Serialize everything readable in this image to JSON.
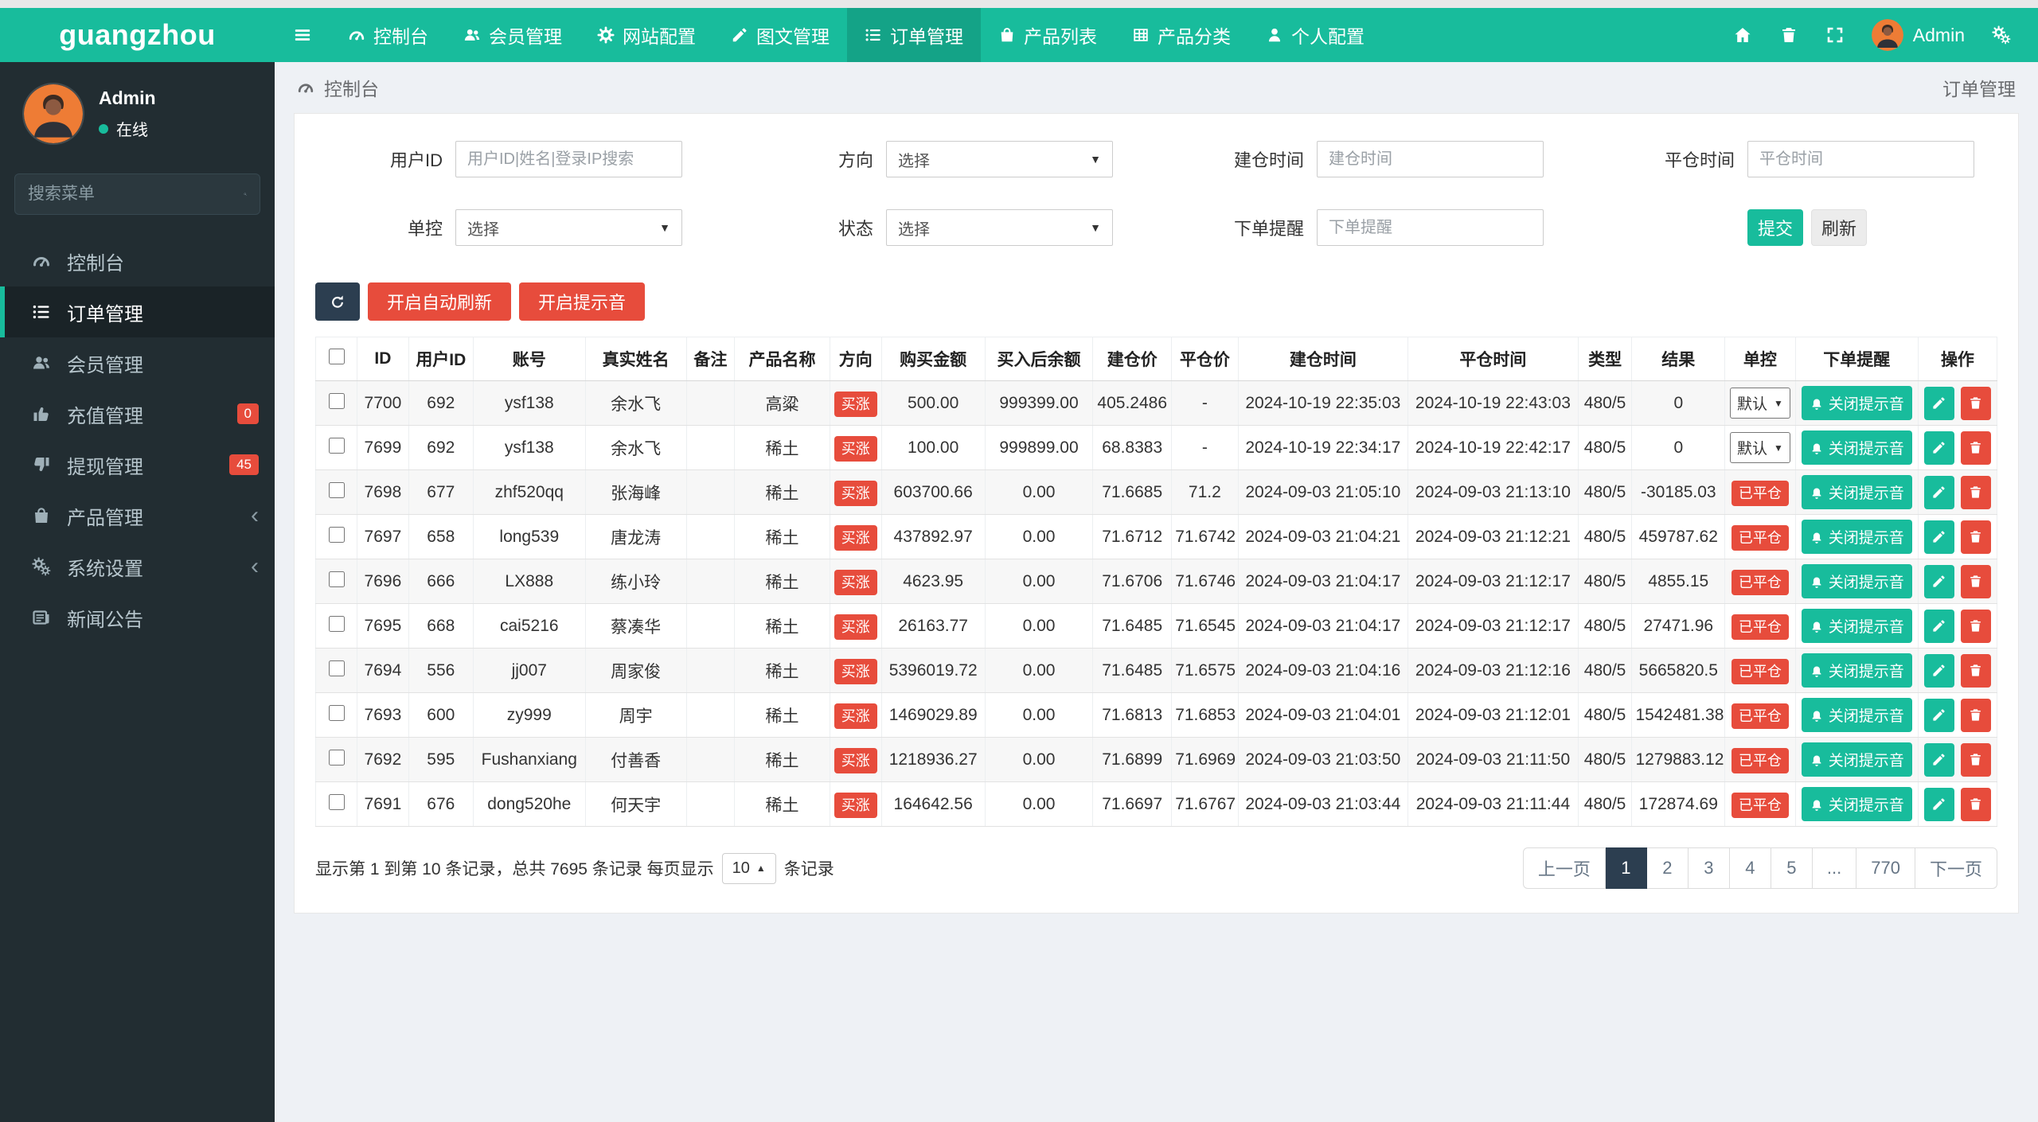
{
  "navbar": {
    "logo": "guangzhou",
    "items": [
      {
        "key": "dashboard",
        "label": "控制台",
        "icon": "gauge",
        "active": false
      },
      {
        "key": "members",
        "label": "会员管理",
        "icon": "users",
        "active": false
      },
      {
        "key": "site-config",
        "label": "网站配置",
        "icon": "gear",
        "active": false
      },
      {
        "key": "content",
        "label": "图文管理",
        "icon": "pen",
        "active": false
      },
      {
        "key": "orders",
        "label": "订单管理",
        "icon": "list",
        "active": true
      },
      {
        "key": "product-list",
        "label": "产品列表",
        "icon": "bag",
        "active": false
      },
      {
        "key": "product-category",
        "label": "产品分类",
        "icon": "table",
        "active": false
      },
      {
        "key": "personal-config",
        "label": "个人配置",
        "icon": "user",
        "active": false
      }
    ],
    "admin_label": "Admin"
  },
  "sidebar": {
    "profile": {
      "name": "Admin",
      "status": "在线"
    },
    "search_placeholder": "搜索菜单",
    "items": [
      {
        "key": "dashboard",
        "label": "控制台",
        "icon": "gauge",
        "active": false,
        "badge": "",
        "chevron": false
      },
      {
        "key": "orders",
        "label": "订单管理",
        "icon": "list",
        "active": true,
        "badge": "",
        "chevron": false
      },
      {
        "key": "members",
        "label": "会员管理",
        "icon": "users",
        "active": false,
        "badge": "",
        "chevron": false
      },
      {
        "key": "recharge",
        "label": "充值管理",
        "icon": "thumb-up",
        "active": false,
        "badge": "0",
        "chevron": false
      },
      {
        "key": "withdraw",
        "label": "提现管理",
        "icon": "thumb-down",
        "active": false,
        "badge": "45",
        "chevron": false
      },
      {
        "key": "products",
        "label": "产品管理",
        "icon": "bag",
        "active": false,
        "badge": "",
        "chevron": true
      },
      {
        "key": "system",
        "label": "系统设置",
        "icon": "cogs",
        "active": false,
        "badge": "",
        "chevron": true
      },
      {
        "key": "news",
        "label": "新闻公告",
        "icon": "news",
        "active": false,
        "badge": "",
        "chevron": false
      }
    ]
  },
  "breadcrumb": {
    "title": "控制台",
    "right": "订单管理"
  },
  "filters": {
    "user_id_label": "用户ID",
    "user_id_placeholder": "用户ID|姓名|登录IP搜索",
    "direction_label": "方向",
    "direction_value": "选择",
    "open_time_label": "建仓时间",
    "open_time_placeholder": "建仓时间",
    "close_time_label": "平仓时间",
    "close_time_placeholder": "平仓时间",
    "control_label": "单控",
    "control_value": "选择",
    "status_label": "状态",
    "status_value": "选择",
    "remind_label": "下单提醒",
    "remind_placeholder": "下单提醒",
    "submit_label": "提交",
    "refresh_label": "刷新"
  },
  "toolbar": {
    "auto_refresh_label": "开启自动刷新",
    "sound_label": "开启提示音"
  },
  "table": {
    "headers": [
      "ID",
      "用户ID",
      "账号",
      "真实姓名",
      "备注",
      "产品名称",
      "方向",
      "购买金额",
      "买入后余额",
      "建仓价",
      "平仓价",
      "建仓时间",
      "平仓时间",
      "类型",
      "结果",
      "单控",
      "下单提醒",
      "操作"
    ],
    "control_select_value": "默认",
    "closed_badge": "已平仓",
    "remind_button_label": "关闭提示音",
    "rows": [
      {
        "id": "7700",
        "uid": "692",
        "account": "ysf138",
        "name": "余水飞",
        "remark": "",
        "product": "高粱",
        "direction": "买涨",
        "amount": "500.00",
        "balance": "999399.00",
        "open_price": "405.2486",
        "close_price": "-",
        "open_time": "2024-10-19 22:35:03",
        "close_time": "2024-10-19 22:43:03",
        "type": "480/5",
        "result": "0",
        "control": "default"
      },
      {
        "id": "7699",
        "uid": "692",
        "account": "ysf138",
        "name": "余水飞",
        "remark": "",
        "product": "稀土",
        "direction": "买涨",
        "amount": "100.00",
        "balance": "999899.00",
        "open_price": "68.8383",
        "close_price": "-",
        "open_time": "2024-10-19 22:34:17",
        "close_time": "2024-10-19 22:42:17",
        "type": "480/5",
        "result": "0",
        "control": "default"
      },
      {
        "id": "7698",
        "uid": "677",
        "account": "zhf520qq",
        "name": "张海峰",
        "remark": "",
        "product": "稀土",
        "direction": "买涨",
        "amount": "603700.66",
        "balance": "0.00",
        "open_price": "71.6685",
        "close_price": "71.2",
        "open_time": "2024-09-03 21:05:10",
        "close_time": "2024-09-03 21:13:10",
        "type": "480/5",
        "result": "-30185.03",
        "control": "closed"
      },
      {
        "id": "7697",
        "uid": "658",
        "account": "long539",
        "name": "唐龙涛",
        "remark": "",
        "product": "稀土",
        "direction": "买涨",
        "amount": "437892.97",
        "balance": "0.00",
        "open_price": "71.6712",
        "close_price": "71.6742",
        "open_time": "2024-09-03 21:04:21",
        "close_time": "2024-09-03 21:12:21",
        "type": "480/5",
        "result": "459787.62",
        "control": "closed"
      },
      {
        "id": "7696",
        "uid": "666",
        "account": "LX888",
        "name": "练小玲",
        "remark": "",
        "product": "稀土",
        "direction": "买涨",
        "amount": "4623.95",
        "balance": "0.00",
        "open_price": "71.6706",
        "close_price": "71.6746",
        "open_time": "2024-09-03 21:04:17",
        "close_time": "2024-09-03 21:12:17",
        "type": "480/5",
        "result": "4855.15",
        "control": "closed"
      },
      {
        "id": "7695",
        "uid": "668",
        "account": "cai5216",
        "name": "蔡凑华",
        "remark": "",
        "product": "稀土",
        "direction": "买涨",
        "amount": "26163.77",
        "balance": "0.00",
        "open_price": "71.6485",
        "close_price": "71.6545",
        "open_time": "2024-09-03 21:04:17",
        "close_time": "2024-09-03 21:12:17",
        "type": "480/5",
        "result": "27471.96",
        "control": "closed"
      },
      {
        "id": "7694",
        "uid": "556",
        "account": "jj007",
        "name": "周家俊",
        "remark": "",
        "product": "稀土",
        "direction": "买涨",
        "amount": "5396019.72",
        "balance": "0.00",
        "open_price": "71.6485",
        "close_price": "71.6575",
        "open_time": "2024-09-03 21:04:16",
        "close_time": "2024-09-03 21:12:16",
        "type": "480/5",
        "result": "5665820.5",
        "control": "closed"
      },
      {
        "id": "7693",
        "uid": "600",
        "account": "zy999",
        "name": "周宇",
        "remark": "",
        "product": "稀土",
        "direction": "买涨",
        "amount": "1469029.89",
        "balance": "0.00",
        "open_price": "71.6813",
        "close_price": "71.6853",
        "open_time": "2024-09-03 21:04:01",
        "close_time": "2024-09-03 21:12:01",
        "type": "480/5",
        "result": "1542481.38",
        "control": "closed"
      },
      {
        "id": "7692",
        "uid": "595",
        "account": "Fushanxiang",
        "name": "付善香",
        "remark": "",
        "product": "稀土",
        "direction": "买涨",
        "amount": "1218936.27",
        "balance": "0.00",
        "open_price": "71.6899",
        "close_price": "71.6969",
        "open_time": "2024-09-03 21:03:50",
        "close_time": "2024-09-03 21:11:50",
        "type": "480/5",
        "result": "1279883.12",
        "control": "closed"
      },
      {
        "id": "7691",
        "uid": "676",
        "account": "dong520he",
        "name": "何天宇",
        "remark": "",
        "product": "稀土",
        "direction": "买涨",
        "amount": "164642.56",
        "balance": "0.00",
        "open_price": "71.6697",
        "close_price": "71.6767",
        "open_time": "2024-09-03 21:03:44",
        "close_time": "2024-09-03 21:11:44",
        "type": "480/5",
        "result": "172874.69",
        "control": "closed"
      }
    ]
  },
  "pagination": {
    "summary_prefix": "显示第 1 到第 10 条记录，总共 7695 条记录 每页显示",
    "page_size": "10",
    "summary_suffix": "条记录",
    "items": [
      "上一页",
      "1",
      "2",
      "3",
      "4",
      "5",
      "...",
      "770",
      "下一页"
    ],
    "active": "1"
  },
  "colors": {
    "accent": "#18bc9c",
    "danger": "#e74c3c",
    "navy": "#2c3e50",
    "sidebar": "#222d32"
  }
}
